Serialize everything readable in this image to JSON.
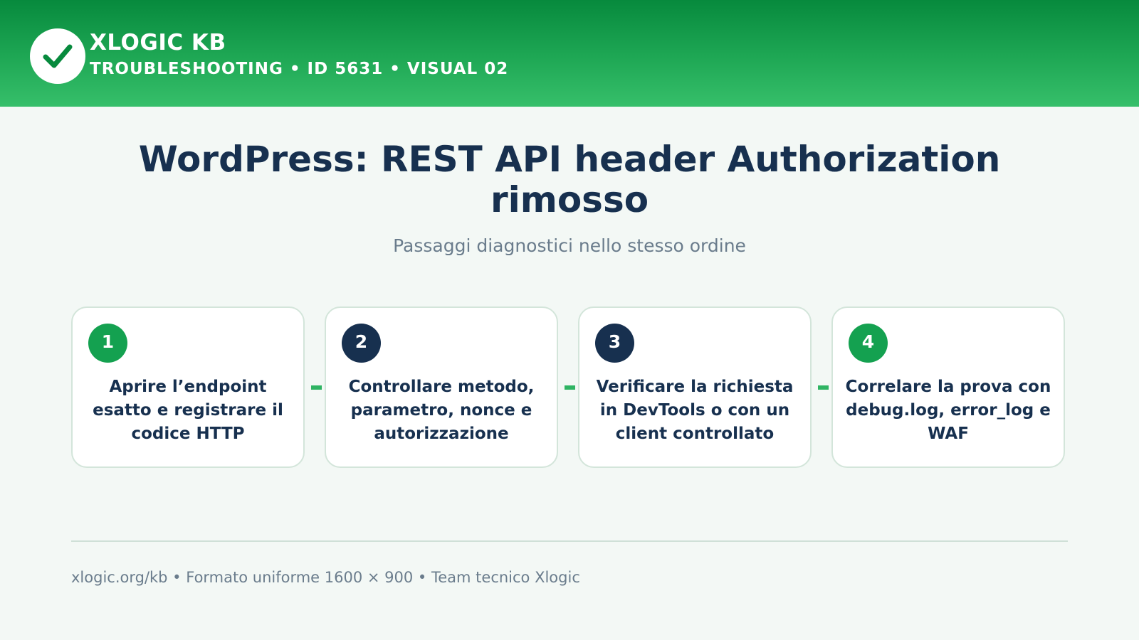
{
  "header": {
    "brand": "XLOGIC KB",
    "meta": "TROUBLESHOOTING • ID 5631 • VISUAL 02",
    "colors": {
      "gradient_top": "#078a3d",
      "gradient_bottom": "#36bf6a"
    },
    "logo_icon": "checkmark-icon"
  },
  "main": {
    "title": "WordPress: REST API header Authorization rimosso",
    "subtitle": "Passaggi diagnostici nello stesso ordine",
    "steps": [
      {
        "number": "1",
        "text": "Aprire l’endpoint esatto e registrare il codice HTTP",
        "badge_color": "#14a150"
      },
      {
        "number": "2",
        "text": "Controllare metodo, parametro, nonce e autorizzazione",
        "badge_color": "#17304f"
      },
      {
        "number": "3",
        "text": "Verificare la richiesta in DevTools o con un client controllato",
        "badge_color": "#17304f"
      },
      {
        "number": "4",
        "text": "Correlare la prova con debug.log, error_log e WAF",
        "badge_color": "#14a150"
      }
    ]
  },
  "footer": {
    "text": "xlogic.org/kb • Formato uniforme 1600 × 900 • Team tecnico Xlogic"
  },
  "colors": {
    "accent_green": "#2fb463",
    "navy": "#17304f",
    "muted_text": "#6a7c8c",
    "background": "#f3f8f5"
  }
}
